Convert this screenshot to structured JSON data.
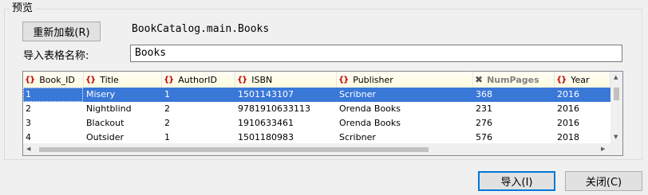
{
  "preview": {
    "group_title": "预览",
    "reload_button": "重新加载(R)",
    "table_path": "BookCatalog.main.Books",
    "name_label": "导入表格名称:",
    "name_value": "Books"
  },
  "grid": {
    "columns": [
      {
        "name": "Book_ID",
        "icon": "brace-icon"
      },
      {
        "name": "Title",
        "icon": "brace-icon"
      },
      {
        "name": "AuthorID",
        "icon": "brace-icon"
      },
      {
        "name": "ISBN",
        "icon": "brace-icon"
      },
      {
        "name": "Publisher",
        "icon": "brace-icon"
      },
      {
        "name": "NumPages",
        "icon": "excluded-icon"
      },
      {
        "name": "Year",
        "icon": "brace-icon"
      }
    ],
    "rows": [
      [
        "1",
        "Misery",
        "1",
        "1501143107",
        "Scribner",
        "368",
        "2016"
      ],
      [
        "2",
        "Nightblind",
        "2",
        "9781910633113",
        "Orenda Books",
        "231",
        "2016"
      ],
      [
        "3",
        "Blackout",
        "2",
        "1910633461",
        "Orenda Books",
        "276",
        "2016"
      ],
      [
        "4",
        "Outsider",
        "1",
        "1501180983",
        "Scribner",
        "576",
        "2018"
      ]
    ]
  },
  "footer": {
    "import_button": "导入(I)",
    "close_button": "关闭(C)"
  },
  "colors": {
    "selection": "#3a78d8",
    "header_icon": "#c00000",
    "primary_border": "#0078d7"
  }
}
